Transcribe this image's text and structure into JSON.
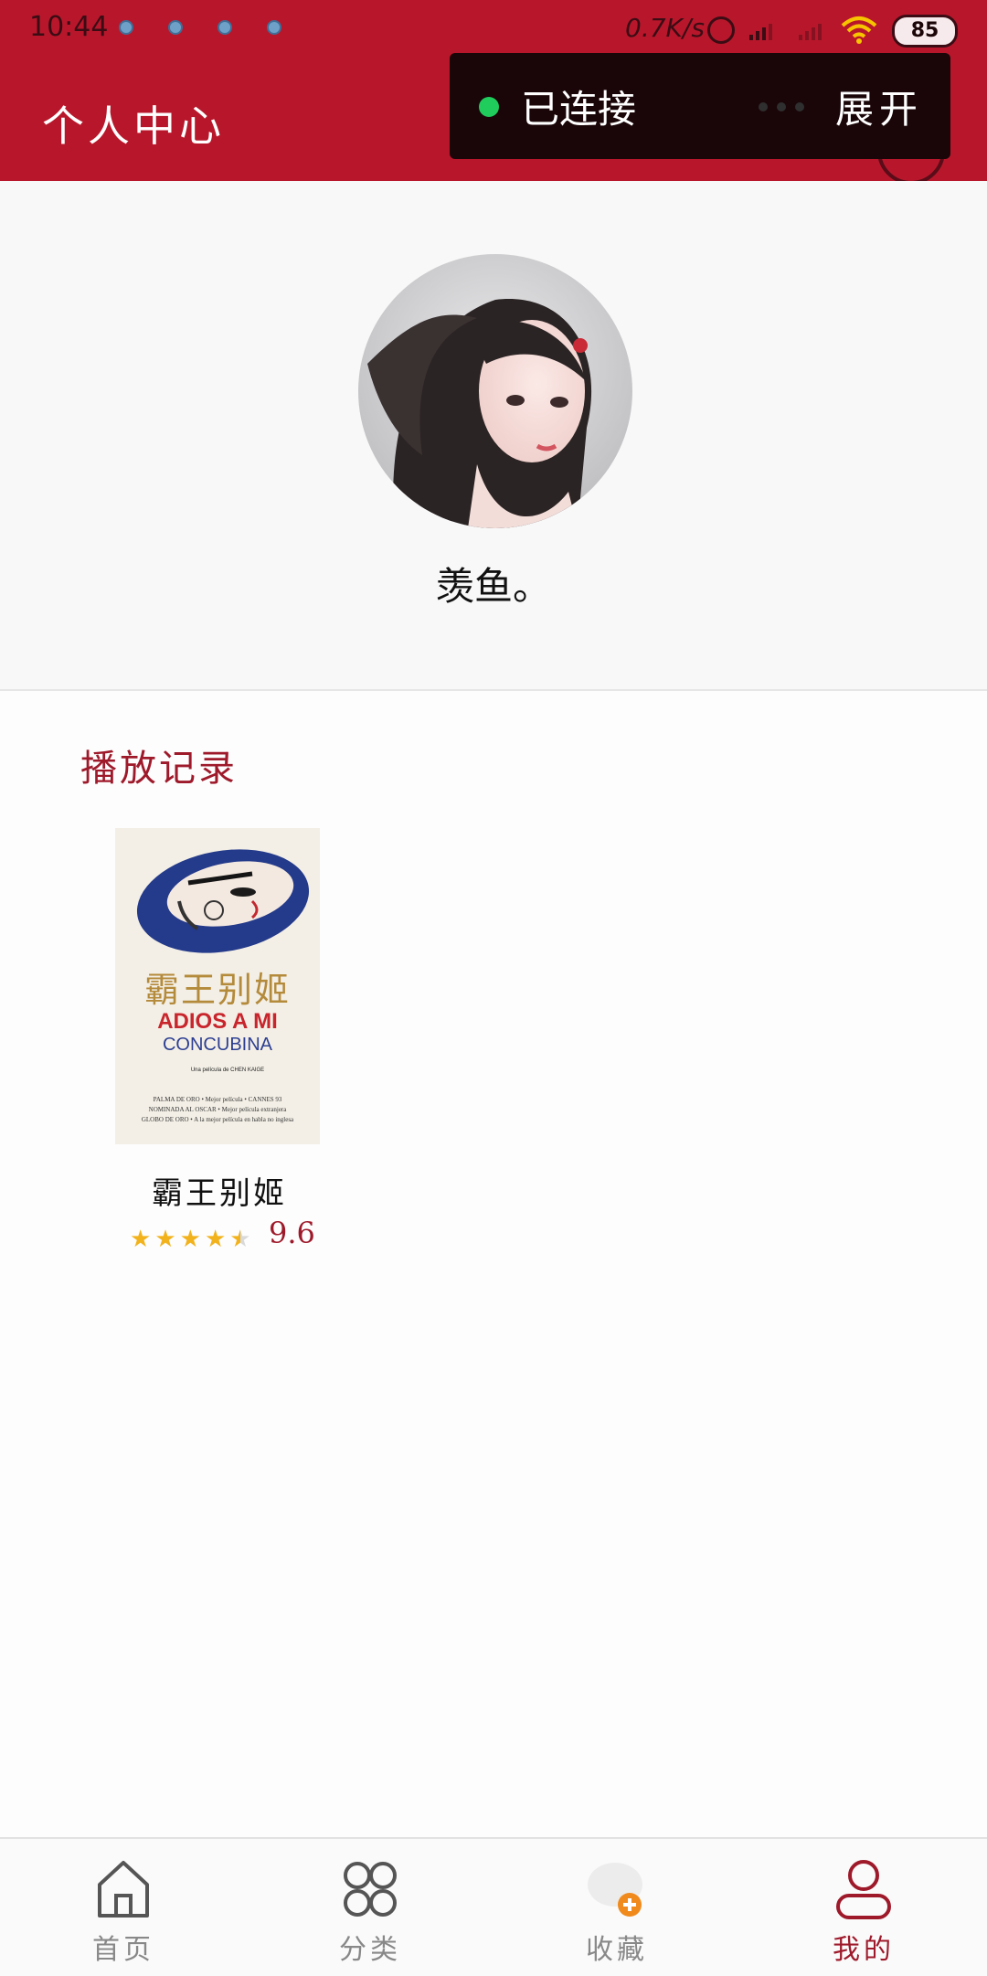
{
  "status_bar": {
    "time": "10:44",
    "net_speed": "0.7K/s",
    "battery": "85"
  },
  "app_bar": {
    "title": "个人中心"
  },
  "connection": {
    "status": "已连接",
    "expand_label": "展开",
    "status_color": "#1fcc5c"
  },
  "profile": {
    "username": "羡鱼。"
  },
  "history": {
    "title": "播放记录",
    "items": [
      {
        "title": "霸王别姬",
        "rating": "9.6",
        "stars": 4.5,
        "poster": {
          "title_cn": "霸王别姬",
          "title_es": "ADIOS A MI",
          "subtitle_es": "CONCUBINA",
          "credit": "Una película de CHEN KAIGE",
          "awards": [
            "PALMA DE ORO • Mejor película • CANNES 93",
            "NOMINADA AL OSCAR • Mejor película extranjera",
            "GLOBO DE ORO • A la mejor película en habla no inglesa"
          ]
        }
      }
    ]
  },
  "tabbar": {
    "tabs": [
      {
        "label": "首页",
        "icon": "home-icon"
      },
      {
        "label": "分类",
        "icon": "category-icon"
      },
      {
        "label": "收藏",
        "icon": "favorite-icon"
      },
      {
        "label": "我的",
        "icon": "user-icon"
      }
    ],
    "active": "我的"
  },
  "colors": {
    "brand": "#b8172b",
    "accent_text": "#9e1a2b",
    "star": "#f2b21c"
  }
}
